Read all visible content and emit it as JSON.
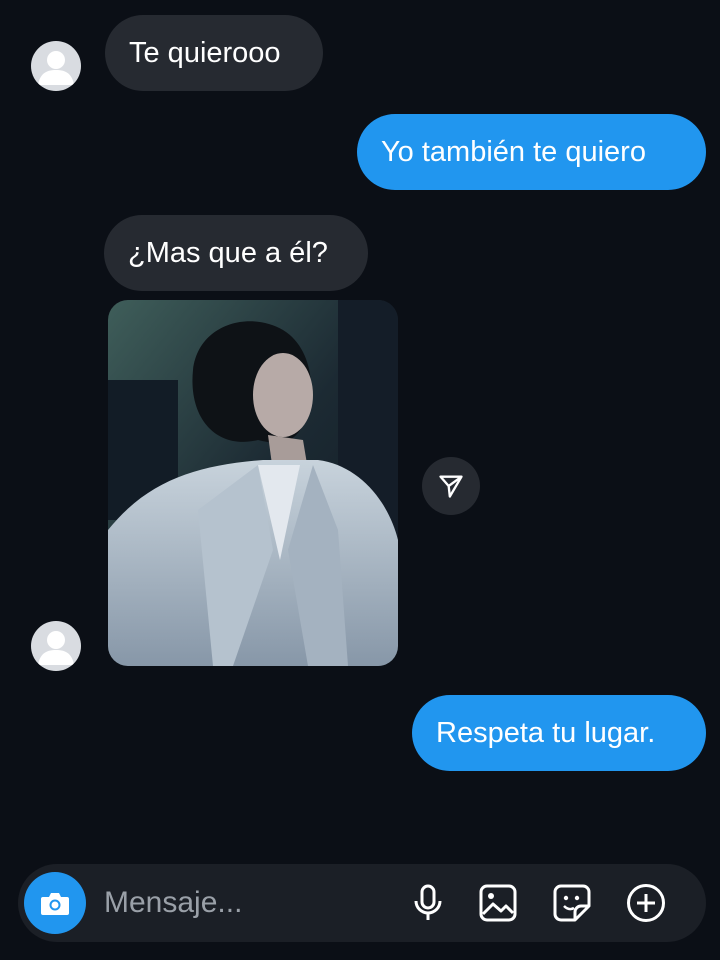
{
  "messages": [
    {
      "direction": "incoming",
      "text": "Te quierooo"
    },
    {
      "direction": "outgoing",
      "text": "Yo también te quiero"
    },
    {
      "direction": "incoming",
      "text": "¿Mas que a él?"
    },
    {
      "direction": "incoming",
      "type": "photo",
      "description_icon": "shared-photo"
    },
    {
      "direction": "outgoing",
      "text": "Respeta tu lugar."
    }
  ],
  "composer": {
    "placeholder": "Mensaje...",
    "icons": [
      "camera-icon",
      "microphone-icon",
      "gallery-icon",
      "sticker-icon",
      "plus-icon"
    ]
  },
  "colors": {
    "background": "#0b0f16",
    "incoming_bubble": "#262a31",
    "outgoing_bubble": "#2196ef",
    "accent": "#2196ef"
  }
}
